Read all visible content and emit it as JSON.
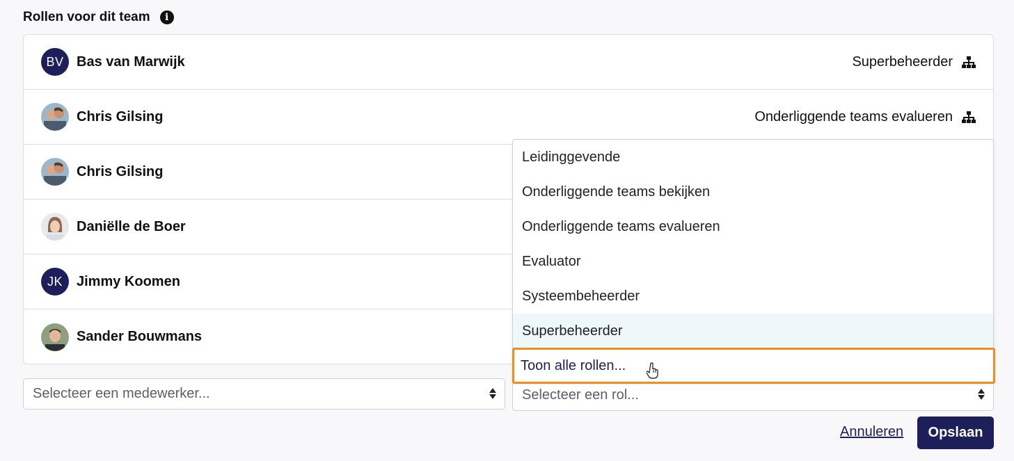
{
  "section": {
    "title": "Rollen voor dit team"
  },
  "members": [
    {
      "name": "Bas van Marwijk",
      "initials": "BV",
      "role": "Superbeheerder"
    },
    {
      "name": "Chris Gilsing",
      "initials": "",
      "role": "Onderliggende teams evalueren"
    },
    {
      "name": "Chris Gilsing",
      "initials": "",
      "role": ""
    },
    {
      "name": "Daniëlle de Boer",
      "initials": "",
      "role": ""
    },
    {
      "name": "Jimmy Koomen",
      "initials": "JK",
      "role": ""
    },
    {
      "name": "Sander Bouwmans",
      "initials": "",
      "role": ""
    }
  ],
  "role_dropdown": {
    "options": [
      "Leidinggevende",
      "Onderliggende teams bekijken",
      "Onderliggende teams evalueren",
      "Evaluator",
      "Systeembeheerder",
      "Superbeheerder"
    ],
    "show_all": "Toon alle rollen..."
  },
  "employee_select": {
    "placeholder": "Selecteer een medewerker..."
  },
  "role_select": {
    "placeholder": "Selecteer een rol..."
  },
  "actions": {
    "cancel": "Annuleren",
    "save": "Opslaan"
  },
  "colors": {
    "brand": "#1c1f5a",
    "focus": "#f28c1e",
    "hover": "#eef7fa"
  },
  "icons": {
    "info": "info-icon",
    "role": "org-chart-icon",
    "arrows": "select-arrows-icon"
  }
}
